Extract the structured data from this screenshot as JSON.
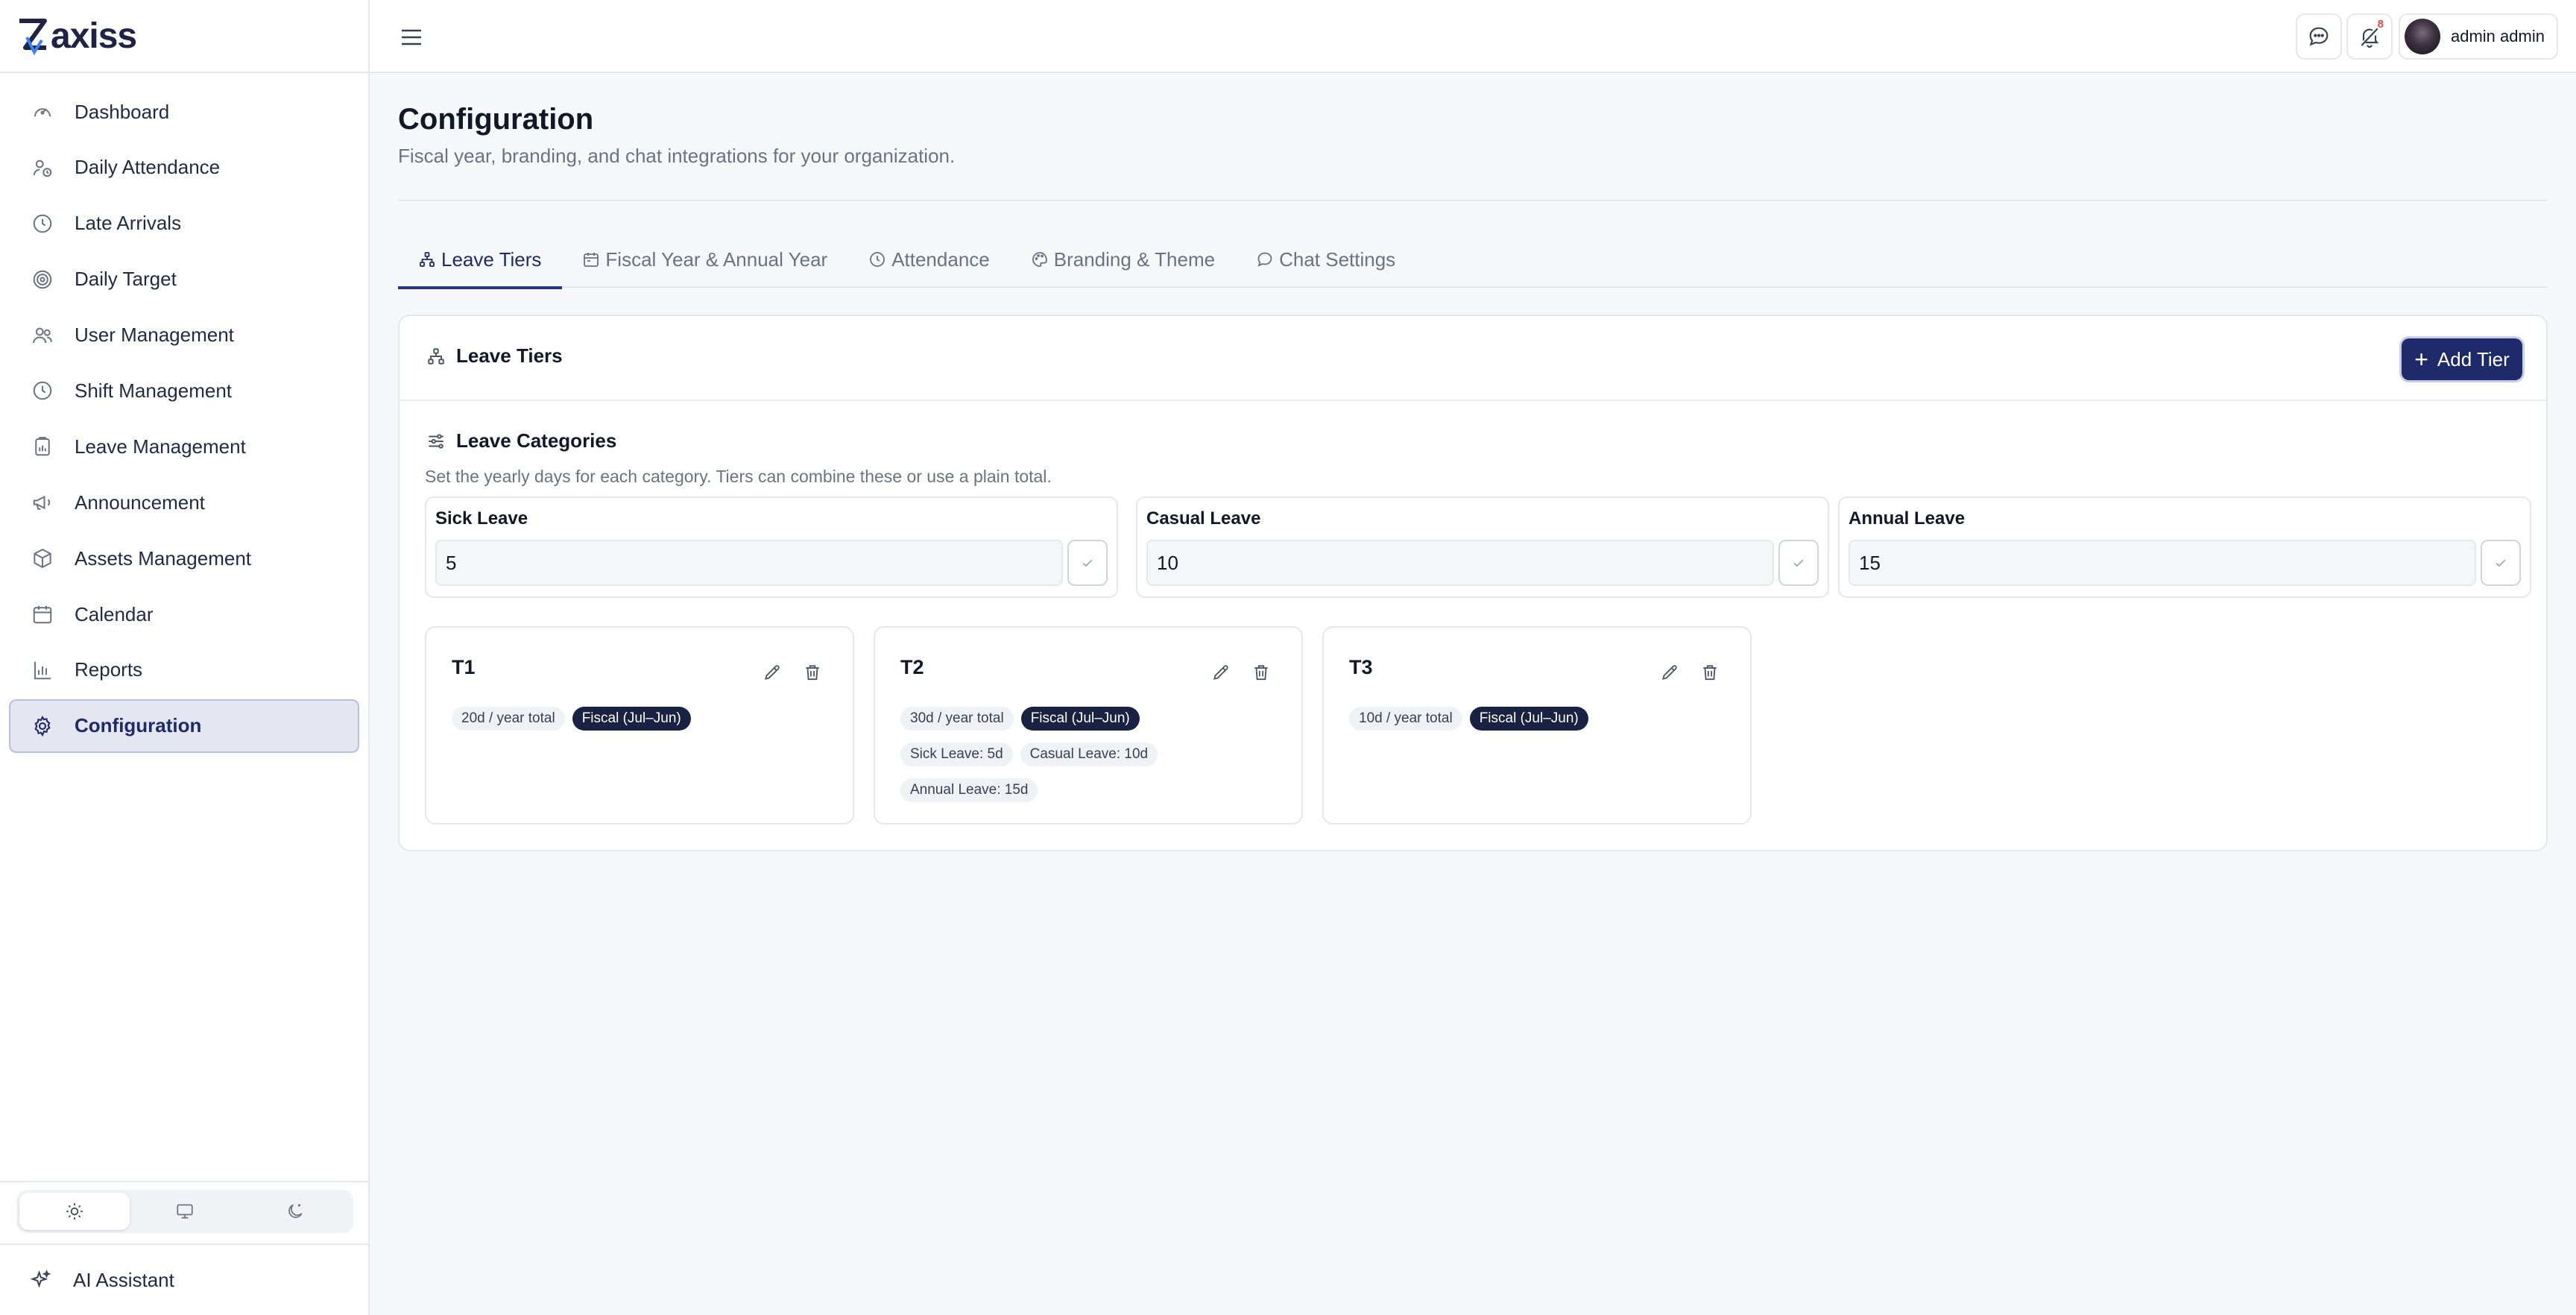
{
  "brand": {
    "name": "axiss",
    "logo_letter": "Z"
  },
  "sidebar": {
    "items": [
      {
        "label": "Dashboard",
        "icon": "gauge-icon"
      },
      {
        "label": "Daily Attendance",
        "icon": "user-clock-icon"
      },
      {
        "label": "Late Arrivals",
        "icon": "clock-icon"
      },
      {
        "label": "Daily Target",
        "icon": "target-icon"
      },
      {
        "label": "User Management",
        "icon": "users-icon"
      },
      {
        "label": "Shift Management",
        "icon": "clock-icon"
      },
      {
        "label": "Leave Management",
        "icon": "clipboard-chart-icon"
      },
      {
        "label": "Announcement",
        "icon": "megaphone-icon"
      },
      {
        "label": "Assets Management",
        "icon": "box-icon"
      },
      {
        "label": "Calendar",
        "icon": "calendar-icon"
      },
      {
        "label": "Reports",
        "icon": "report-chart-icon"
      },
      {
        "label": "Configuration",
        "icon": "gear-icon",
        "active": true
      }
    ],
    "theme_options": [
      "light",
      "system",
      "dark"
    ],
    "ai_assistant_label": "AI Assistant"
  },
  "header": {
    "notification_count": "8",
    "user_name": "admin admin"
  },
  "page": {
    "title": "Configuration",
    "subtitle": "Fiscal year, branding, and chat integrations for your organization."
  },
  "tabs": [
    {
      "label": "Leave Tiers",
      "active": true
    },
    {
      "label": "Fiscal Year & Annual Year"
    },
    {
      "label": "Attendance"
    },
    {
      "label": "Branding & Theme"
    },
    {
      "label": "Chat Settings"
    }
  ],
  "leave_tiers_card": {
    "title": "Leave Tiers",
    "add_button_label": "Add Tier",
    "categories_title": "Leave Categories",
    "categories_description": "Set the yearly days for each category. Tiers can combine these or use a plain total.",
    "categories": [
      {
        "label": "Sick Leave",
        "value": "5"
      },
      {
        "label": "Casual Leave",
        "value": "10"
      },
      {
        "label": "Annual Leave",
        "value": "15"
      }
    ],
    "tiers": [
      {
        "name": "T1",
        "total": "20d / year total",
        "period": "Fiscal (Jul–Jun)",
        "breakdown": []
      },
      {
        "name": "T2",
        "total": "30d / year total",
        "period": "Fiscal (Jul–Jun)",
        "breakdown": [
          "Sick Leave: 5d",
          "Casual Leave: 10d",
          "Annual Leave: 15d"
        ]
      },
      {
        "name": "T3",
        "total": "10d / year total",
        "period": "Fiscal (Jul–Jun)",
        "breakdown": []
      }
    ]
  },
  "colors": {
    "accent": "#1f2a6b",
    "active_nav_bg": "#e4e6f2",
    "badge_red": "#ef4444",
    "dark_chip": "#1a2244"
  }
}
